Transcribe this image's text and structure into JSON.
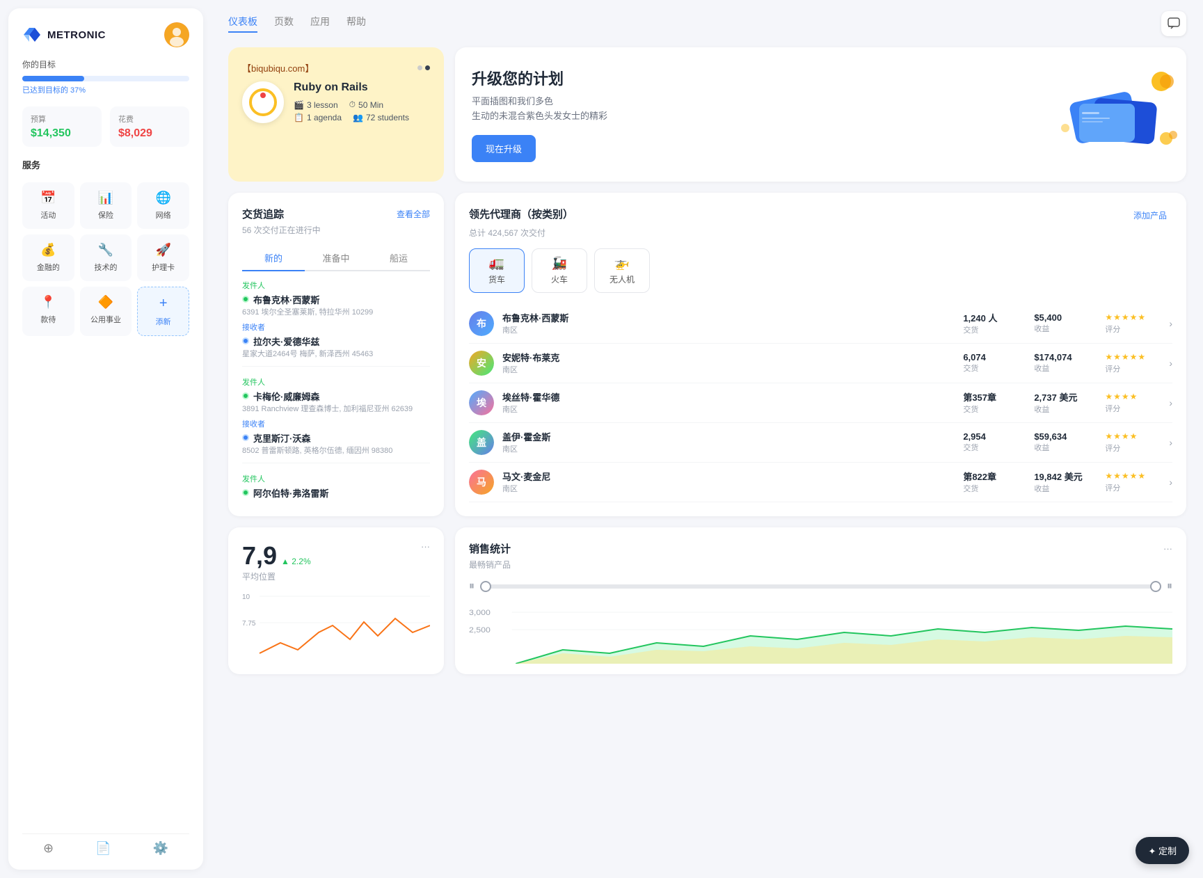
{
  "sidebar": {
    "logo": "METRONIC",
    "goal_label": "你的目标",
    "goal_percent": "已达到目标的 37%",
    "progress_value": 37,
    "budget_label": "预算",
    "budget_value": "$14,350",
    "expense_label": "花费",
    "expense_value": "$8,029",
    "services_label": "服务",
    "services": [
      {
        "name": "活动",
        "icon": "📅"
      },
      {
        "name": "保险",
        "icon": "📊"
      },
      {
        "name": "网络",
        "icon": "🌐"
      },
      {
        "name": "金融的",
        "icon": "💰"
      },
      {
        "name": "技术的",
        "icon": "🔧"
      },
      {
        "name": "护理卡",
        "icon": "🚀"
      },
      {
        "name": "款待",
        "icon": "📍"
      },
      {
        "name": "公用事业",
        "icon": "🔶"
      },
      {
        "name": "添新",
        "icon": "+"
      }
    ],
    "bottom_icons": [
      "layers",
      "file",
      "settings"
    ]
  },
  "nav": {
    "links": [
      "仪表板",
      "页数",
      "应用",
      "帮助"
    ],
    "active": "仪表板"
  },
  "course_card": {
    "url": "【biqubiqu.com】",
    "title": "Ruby on Rails",
    "lessons": "3 lesson",
    "duration": "50 Min",
    "agenda": "1 agenda",
    "students": "72 students"
  },
  "upgrade_card": {
    "title": "升级您的计划",
    "desc_line1": "平面插图和我们多色",
    "desc_line2": "生动的未混合紫色头发女士的精彩",
    "btn_label": "现在升级"
  },
  "tracking": {
    "title": "交货追踪",
    "subtitle": "56 次交付正在进行中",
    "link": "查看全部",
    "tabs": [
      "新的",
      "准备中",
      "船运"
    ],
    "active_tab": "新的",
    "items": [
      {
        "sender_label": "发件人",
        "sender_name": "布鲁克林·西蒙斯",
        "sender_addr": "6391 埃尔全圣塞莱斯, 特拉华州 10299",
        "receiver_label": "接收者",
        "receiver_name": "拉尔夫·爱德华兹",
        "receiver_addr": "星家大道2464号 梅萨, 新泽西州 45463"
      },
      {
        "sender_label": "发件人",
        "sender_name": "卡梅伦·威廉姆森",
        "sender_addr": "3891 Ranchview 理查森博士, 加利福尼亚州 62639",
        "receiver_label": "接收者",
        "receiver_name": "克里斯汀·沃森",
        "receiver_addr": "8502 普雷斯顿路, 英格尔伍德, 缅因州 98380"
      },
      {
        "sender_label": "发件人",
        "sender_name": "阿尔伯特·弗洛雷斯",
        "sender_addr": "",
        "receiver_label": "",
        "receiver_name": "",
        "receiver_addr": ""
      }
    ]
  },
  "agents": {
    "title": "领先代理商（按类别）",
    "total": "总计 424,567 次交付",
    "add_btn": "添加产品",
    "categories": [
      {
        "icon": "🚛",
        "label": "货车",
        "active": true
      },
      {
        "icon": "🚂",
        "label": "火车",
        "active": false
      },
      {
        "icon": "🚁",
        "label": "无人机",
        "active": false
      }
    ],
    "agents": [
      {
        "name": "布鲁克林·西蒙斯",
        "region": "南区",
        "transactions": "1,240 人",
        "trans_label": "交货",
        "revenue": "$5,400",
        "rev_label": "收益",
        "stars": 5,
        "rating_label": "评分",
        "avatar_color": "av1"
      },
      {
        "name": "安妮特·布莱克",
        "region": "南区",
        "transactions": "6,074",
        "trans_label": "交货",
        "revenue": "$174,074",
        "rev_label": "收益",
        "stars": 5,
        "rating_label": "评分",
        "avatar_color": "av2"
      },
      {
        "name": "埃丝特·霍华德",
        "region": "南区",
        "transactions": "第357章",
        "trans_label": "交货",
        "revenue": "2,737 美元",
        "rev_label": "收益",
        "stars": 4,
        "rating_label": "评分",
        "avatar_color": "av3"
      },
      {
        "name": "盖伊·霍金斯",
        "region": "南区",
        "transactions": "2,954",
        "trans_label": "交货",
        "revenue": "$59,634",
        "rev_label": "收益",
        "stars": 4,
        "half_star": true,
        "rating_label": "评分",
        "avatar_color": "av4"
      },
      {
        "name": "马文·麦金尼",
        "region": "南区",
        "transactions": "第822章",
        "trans_label": "交货",
        "revenue": "19,842 美元",
        "rev_label": "收益",
        "stars": 5,
        "rating_label": "评分",
        "avatar_color": "av5"
      }
    ]
  },
  "avg_position": {
    "value": "7,9",
    "change": "▲ 2.2%",
    "label": "平均位置",
    "y_labels": [
      "10",
      "",
      "7.75",
      "",
      ""
    ],
    "dots_menu": "..."
  },
  "sales": {
    "title": "销售统计",
    "subtitle": "最畅销产品",
    "dots_menu": "...",
    "y_labels": [
      "3,000",
      "2,500"
    ],
    "slider_left": "▐",
    "slider_right": "▐"
  },
  "customize": {
    "btn_label": "✦ 定制"
  }
}
